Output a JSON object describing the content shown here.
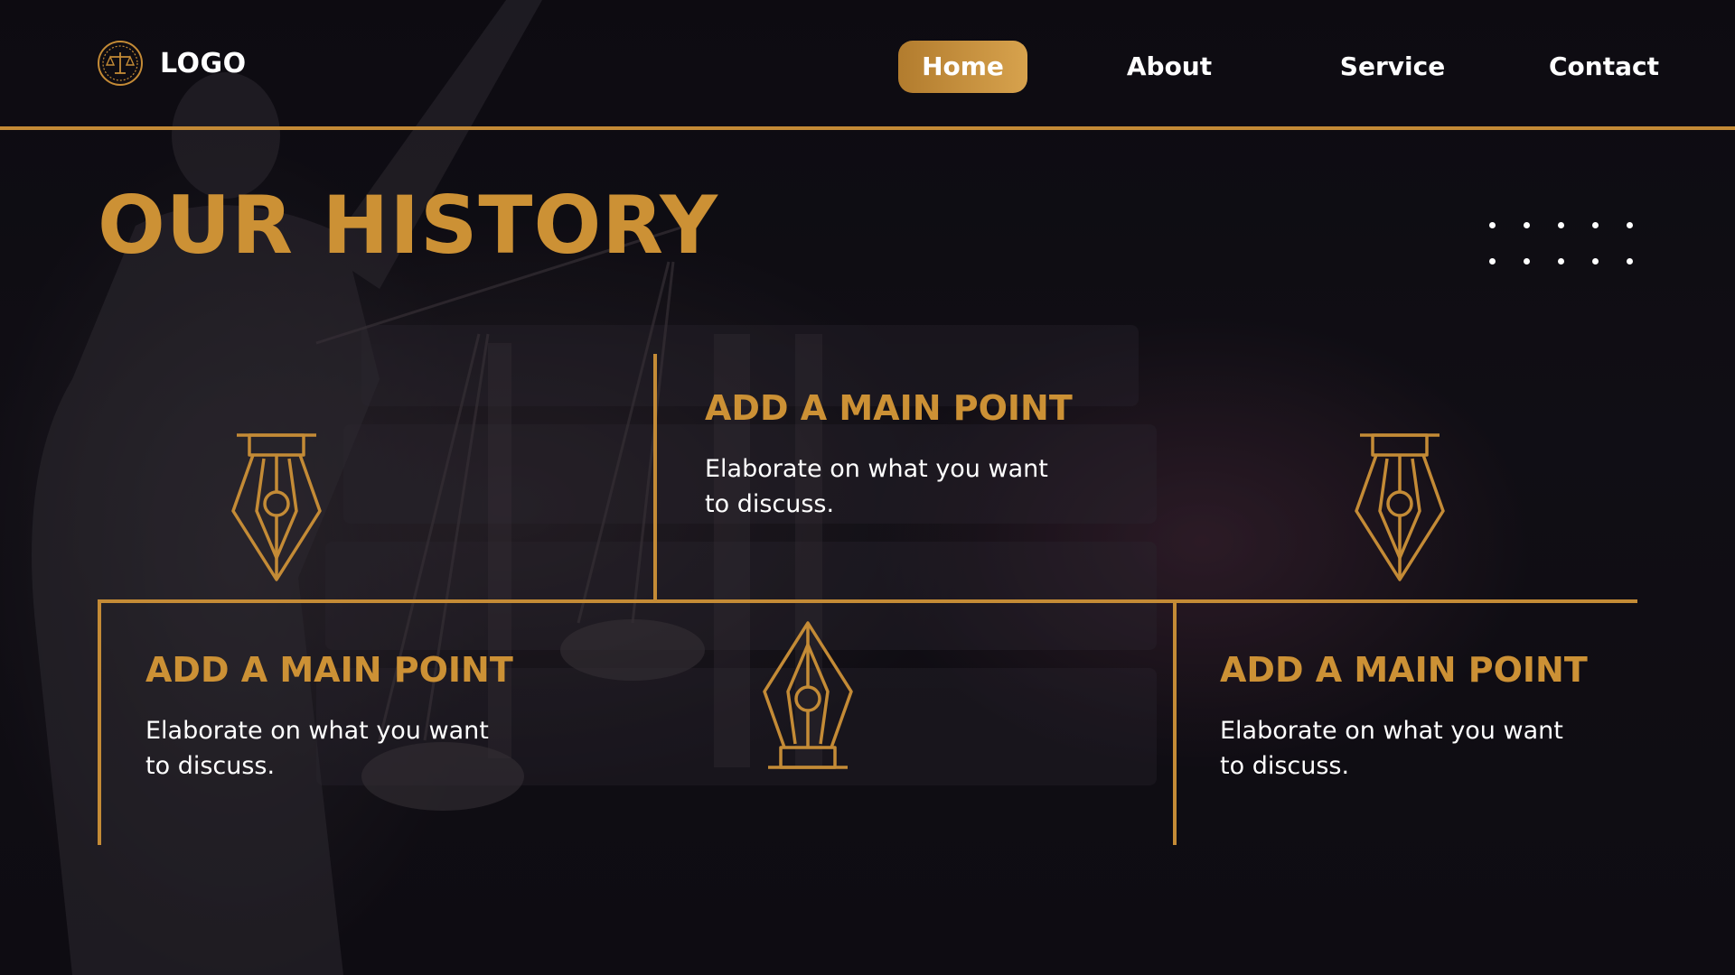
{
  "header": {
    "logo_text": "LOGO",
    "logo_icon": "scales-of-justice-icon",
    "nav": [
      {
        "label": "Home",
        "active": true
      },
      {
        "label": "About",
        "active": false
      },
      {
        "label": "Service",
        "active": false
      },
      {
        "label": "Contact",
        "active": false
      }
    ]
  },
  "main": {
    "title": "OUR HISTORY",
    "points": [
      {
        "heading": "ADD A MAIN POINT",
        "body": "Elaborate on what you want to discuss."
      },
      {
        "heading": "ADD A MAIN POINT",
        "body": "Elaborate on what you want to discuss."
      },
      {
        "heading": "ADD A MAIN POINT",
        "body": "Elaborate on what you want to discuss."
      }
    ],
    "icons": [
      "fountain-pen-nib-icon",
      "fountain-pen-nib-icon",
      "fountain-pen-nib-icon"
    ]
  },
  "colors": {
    "accent": "#c48b36",
    "heading": "#cc9135",
    "background": "#0f0d13",
    "text": "#ffffff"
  }
}
